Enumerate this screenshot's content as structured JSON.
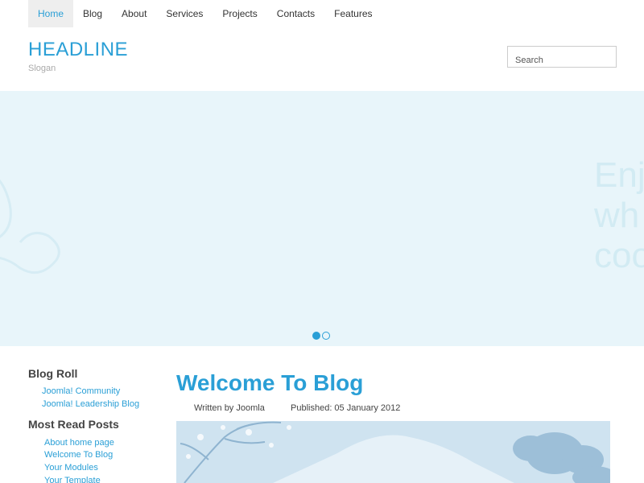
{
  "nav": {
    "items": [
      {
        "label": "Home",
        "active": true
      },
      {
        "label": "Blog",
        "active": false
      },
      {
        "label": "About",
        "active": false
      },
      {
        "label": "Services",
        "active": false
      },
      {
        "label": "Projects",
        "active": false
      },
      {
        "label": "Contacts",
        "active": false
      },
      {
        "label": "Features",
        "active": false
      }
    ]
  },
  "header": {
    "headline": "HEADLINE",
    "slogan": "Slogan",
    "search_placeholder": "Search"
  },
  "banner": {
    "text_lines": [
      "Enj",
      "wh",
      "coo"
    ],
    "dots": [
      {
        "active": true
      },
      {
        "active": false
      }
    ]
  },
  "sidebar": {
    "blog_roll": {
      "heading": "Blog Roll",
      "links": [
        "Joomla! Community",
        "Joomla! Leadership Blog"
      ]
    },
    "most_read": {
      "heading": "Most Read Posts",
      "links": [
        "About home page",
        "Welcome To Blog",
        "Your Modules",
        "Your Template"
      ]
    }
  },
  "article": {
    "title": "Welcome To Blog",
    "written_by": "Written by Joomla",
    "published": "Published: 05 January 2012"
  },
  "colors": {
    "accent": "#2a9fd6",
    "banner_bg": "#e8f5fa",
    "nav_active_bg": "#eeeeee"
  }
}
